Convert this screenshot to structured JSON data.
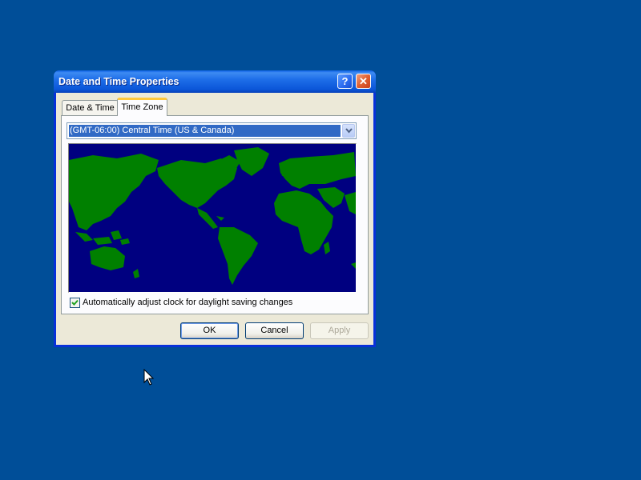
{
  "dialog": {
    "title": "Date and Time Properties",
    "help_glyph": "?",
    "close_glyph": "✕"
  },
  "tabs": [
    {
      "label": "Date & Time",
      "active": false
    },
    {
      "label": "Time Zone",
      "active": true
    }
  ],
  "timezone": {
    "selected": "(GMT-06:00) Central Time (US & Canada)"
  },
  "daylight": {
    "label": "Automatically adjust clock for daylight saving changes",
    "checked": true
  },
  "buttons": {
    "ok": "OK",
    "cancel": "Cancel",
    "apply": "Apply",
    "apply_enabled": false
  },
  "colors": {
    "desktop": "#004e98",
    "ocean": "#000080",
    "land": "#008000",
    "selection": "#316ac5"
  },
  "icons": {
    "dropdown": "chevron-down-icon",
    "checkbox": "checkmark-icon",
    "cursor": "mouse-pointer-icon"
  }
}
